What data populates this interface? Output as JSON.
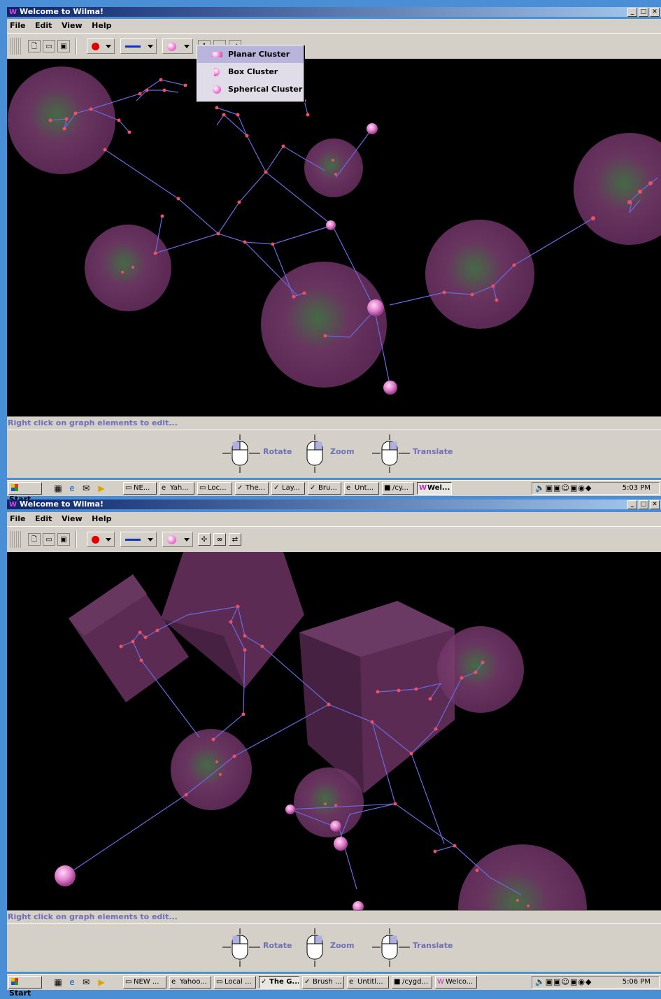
{
  "screens": [
    {
      "window_title": "Welcome to Wilma!",
      "menu": [
        "File",
        "Edit",
        "View",
        "Help"
      ],
      "status_hint": "Right click on graph elements to edit...",
      "controls": [
        "Rotate",
        "Zoom",
        "Translate"
      ],
      "taskbar": {
        "start_label": "Start",
        "tasks": [
          "NE...",
          "Yah...",
          "Loc...",
          "The...",
          "Lay...",
          "Bru...",
          "Unt...",
          "/cy...",
          "Wel..."
        ],
        "active_task": "Wel...",
        "clock": "5:03 PM"
      },
      "popup_menu": [
        "Planar Cluster",
        "Box Cluster",
        "Spherical Cluster"
      ],
      "popup_selected": "Planar Cluster"
    },
    {
      "window_title": "Welcome to Wilma!",
      "menu": [
        "File",
        "Edit",
        "View",
        "Help"
      ],
      "status_hint": "Right click on graph elements to edit...",
      "controls": [
        "Rotate",
        "Zoom",
        "Translate"
      ],
      "taskbar": {
        "start_label": "Start",
        "tasks": [
          "NEW ...",
          "Yahoo...",
          "Local ...",
          "The G...",
          "Brush ...",
          "Untitl...",
          "/cygd...",
          "Welco..."
        ],
        "active_task": "The G...",
        "clock": "5:06 PM"
      }
    }
  ],
  "icons": {
    "window_logo": "wilma-w-icon",
    "toolbar": [
      "new-file-icon",
      "open-folder-icon",
      "save-disk-icon",
      "node-color-icon",
      "edge-style-icon",
      "cluster-type-icon",
      "cluster-select-icon",
      "binoculars-icon",
      "layout-icon"
    ],
    "quick_launch": [
      "desktop-icon",
      "ie-icon",
      "outlook-icon",
      "media-icon"
    ]
  },
  "colors": {
    "title_start": "#0a246a",
    "title_end": "#a6caf0",
    "chrome": "#d4d0c8",
    "status_text": "#6f6fb7",
    "node": "#f05060",
    "edge": "#6a6ae0",
    "sphere": "#7a3a6e"
  }
}
